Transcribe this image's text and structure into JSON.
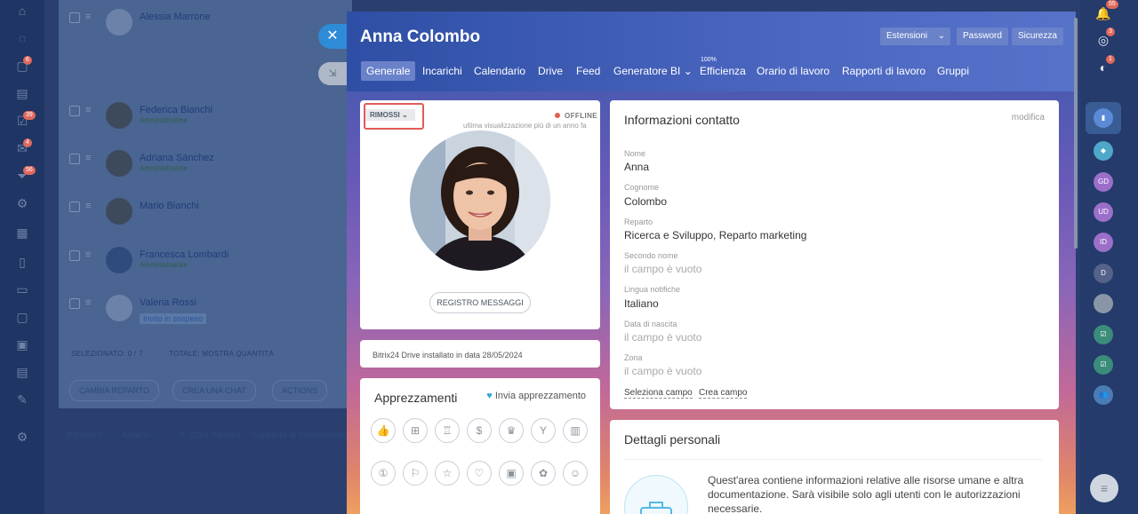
{
  "left_nav": {
    "badges": [
      "6",
      "39",
      "4",
      "56"
    ]
  },
  "list": {
    "rows": [
      {
        "name": "Alessia Marrone",
        "role": ""
      },
      {
        "name": "Federica Bianchi",
        "role": "Amministratore"
      },
      {
        "name": "Adriana Sánchez",
        "role": "Amministratore"
      },
      {
        "name": "Mario Bianchi",
        "role": ""
      },
      {
        "name": "Francesca Lombardi",
        "role": "Amministratore"
      },
      {
        "name": "Valeria Rossi",
        "role": "",
        "pending": "Invito in sospeso"
      }
    ],
    "selected": "SELEZIONATO: 0 / 7",
    "total": "TOTALE: MOSTRA QUANTITÀ",
    "btn_change": "CAMBIA REPARTO",
    "btn_chat": "CREA UNA CHAT",
    "btn_actions": "ACTIONS",
    "bottom_brand": "Bitrix24®",
    "bottom_lang": "Italiano",
    "bottom_copy": "© 2024 Bitrix24",
    "bottom_link": "Supporto di implementazione"
  },
  "profile": {
    "name": "Anna Colombo",
    "header_buttons": {
      "extensions": "Estensioni",
      "password": "Password",
      "security": "Sicurezza"
    },
    "tabs": [
      "Generale",
      "Incarichi",
      "Calendario",
      "Drive",
      "Feed",
      "Generatore BI",
      "Efficienza",
      "Orario di lavoro",
      "Rapporti di lavoro",
      "Gruppi"
    ],
    "efficiency_badge": "100%",
    "status_label": "RIMOSSI",
    "online_status": "OFFLINE",
    "last_seen": "ultima visualizzazione più di un anno fa",
    "message_log_button": "REGISTRO MESSAGGI",
    "drive_info": "Bitrix24 Drive installato in data 28/05/2024",
    "appreciations_title": "Apprezzamenti",
    "send_appreciation": "Invia apprezzamento"
  },
  "contact": {
    "title": "Informazioni contatto",
    "edit": "modifica",
    "fields": [
      {
        "label": "Nome",
        "value": "Anna",
        "empty": false
      },
      {
        "label": "Cognome",
        "value": "Colombo",
        "empty": false
      },
      {
        "label": "Reparto",
        "value": "Ricerca e Sviluppo, Reparto marketing",
        "empty": false
      },
      {
        "label": "Secondo nome",
        "value": "il campo è vuoto",
        "empty": true
      },
      {
        "label": "Lingua notifiche",
        "value": "Italiano",
        "empty": false
      },
      {
        "label": "Data di nascita",
        "value": "il campo è vuoto",
        "empty": true
      },
      {
        "label": "Zona",
        "value": "il campo è vuoto",
        "empty": true
      }
    ],
    "select_field": "Seleziona campo",
    "create_field": "Crea campo"
  },
  "personal": {
    "title": "Dettagli personali",
    "text": "Quest'area contiene informazioni relative alle risorse umane e altra documentazione. Sarà visibile solo agli utenti con le autorizzazioni necessarie."
  },
  "right_bar": {
    "badges": [
      "55",
      "3",
      "1"
    ],
    "avatars": [
      "GD",
      "UD",
      "ID",
      "D"
    ]
  },
  "colors": {
    "accent": "#2e8bd8",
    "highlight": "#e25b5b",
    "offline": "#e06050"
  }
}
